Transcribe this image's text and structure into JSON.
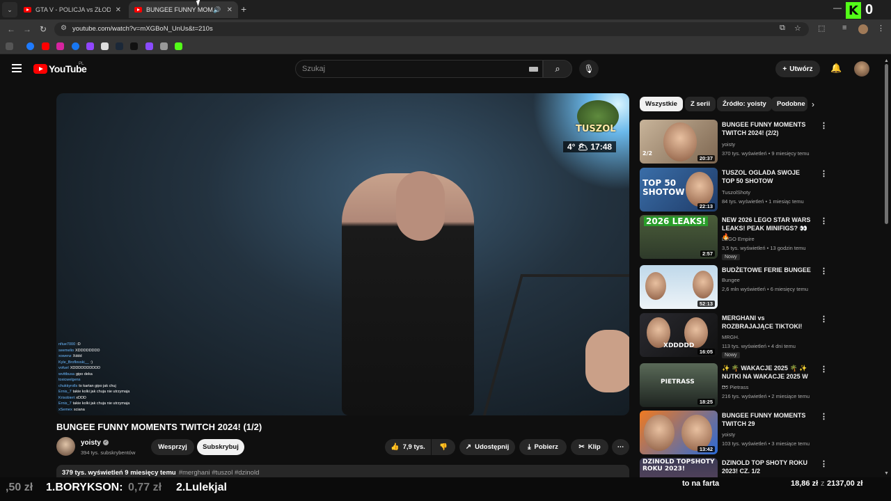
{
  "browser": {
    "tabs": [
      {
        "title": "GTA V - POLICJA vs ZŁODZIEJE"
      },
      {
        "title": "BUNGEE FUNNY MOMENTS"
      }
    ],
    "url": "youtube.com/watch?v=mXGBoN_UnUs&t=210s",
    "kick_count": "0",
    "kick_letter": "K"
  },
  "youtube": {
    "logo_text": "YouTube",
    "country_code": "PL",
    "search_placeholder": "Szukaj",
    "create_label": "Utwórz"
  },
  "player": {
    "watermark": "TUSZOL",
    "weather": "4° 🌥 17:48",
    "chat": [
      {
        "user": "nfiue7000",
        "msg": ":D"
      },
      {
        "user": "seemelio",
        "msg": "XDDDDDDDD"
      },
      {
        "user": "xowenz",
        "msg": "Xddd"
      },
      {
        "user": "Kyle_Broflovski__",
        "msg": ":)"
      },
      {
        "user": "vofuel",
        "msg": "XDDDDDDDDDD"
      },
      {
        "user": "wvittbusa",
        "msg": "gipo deka"
      },
      {
        "user": "toxicwelgens",
        "msg": ""
      },
      {
        "user": "chukkyrolls",
        "msg": "to kartan gipo jak chuj"
      },
      {
        "user": "Ernis_7",
        "msg": "takie kolki jak chuja nie utrzymaja"
      },
      {
        "user": "Krisobiert",
        "msg": "xDDD"
      },
      {
        "user": "Ernis_7",
        "msg": "takie kolki jak chuja nie utrzymaja"
      },
      {
        "user": "xSemex",
        "msg": "sciana"
      }
    ]
  },
  "video": {
    "title": "BUNGEE FUNNY MOMENTS TWITCH 2024! (1/2)",
    "channel": "yoisty",
    "subscribers": "394 tys. subskrybentów",
    "support_label": "Wesprzyj",
    "subscribe_label": "Subskrybuj",
    "likes": "7,9 tys.",
    "share_label": "Udostępnij",
    "download_label": "Pobierz",
    "clip_label": "Klip",
    "views_date": "379 tys. wyświetleń  9 miesięcy temu",
    "tags": "#merghani #tuszol #dzinold"
  },
  "sidebar": {
    "chips": [
      "Wszystkie",
      "Z serii",
      "Źródło: yoisty",
      "Podobne"
    ],
    "recommendations": [
      {
        "title": "BUNGEE FUNNY MOMENTS TWITCH 2024! (2/2)",
        "channel": "yoisty",
        "meta": "370 tys. wyświetleń • 9 miesięcy temu",
        "duration": "20:37",
        "badge": "",
        "thumb_text": "2/2"
      },
      {
        "title": "TUSZOL OGLADA SWOJE TOP 50 SHOTOW",
        "channel": "TuszolShoty",
        "meta": "84 tys. wyświetleń • 1 miesiąc temu",
        "duration": "22:13",
        "badge": "",
        "thumb_text": "TOP 50 SHOTOW"
      },
      {
        "title": "NEW 2026 LEGO STAR WARS LEAKS! PEAK MINIFIGS? 👀 🔥",
        "channel": "LEGO Empire",
        "meta": "3,5 tys. wyświetleń • 13 godzin temu",
        "duration": "2:57",
        "badge": "Nowy",
        "thumb_text": "2026 LEAKS!"
      },
      {
        "title": "BUDŻETOWE FERIE BUNGEE",
        "channel": "Bungee",
        "meta": "2,6 mln wyświetleń • 6 miesięcy temu",
        "duration": "52:13",
        "badge": "",
        "thumb_text": ""
      },
      {
        "title": "MERGHANI vs ROZBRAJAJĄCE TIKTOKI!",
        "channel": "MRGH.",
        "meta": "113 tys. wyświetleń • 4 dni temu",
        "duration": "16:05",
        "badge": "Nowy",
        "thumb_text": "XDDDDD"
      },
      {
        "title": "✨ 🌴 WAKACJE 2025 🌴 ✨ NUTKI NA WAKACJE 2025 W ...",
        "channel": "DJ Pietrass",
        "meta": "216 tys. wyświetleń • 2 miesiące temu",
        "duration": "18:25",
        "badge": "",
        "thumb_text": "PIETRASS"
      },
      {
        "title": "BUNGEE FUNNY MOMENTS TWITCH 29",
        "channel": "yoisty",
        "meta": "103 tys. wyświetleń • 3 miesiące temu",
        "duration": "13:42",
        "badge": "",
        "thumb_text": ""
      },
      {
        "title": "DZINOLD TOP SHOTY ROKU 2023! CZ. 1/2",
        "channel": "",
        "meta": "",
        "duration": "",
        "badge": "",
        "thumb_text": "DZINOLD TOPSHOTY ROKU 2023!"
      }
    ]
  },
  "stream_overlay": {
    "left_amount": ",50 zł",
    "rank1": "1.BORYKSON:",
    "rank1_amount": "0,77 zł",
    "rank2": "2.Lulekjal",
    "goal_label": "to na farta",
    "goal_progress": "18,86 zł",
    "goal_sep": "z",
    "goal_total": "2137,00 zł"
  }
}
